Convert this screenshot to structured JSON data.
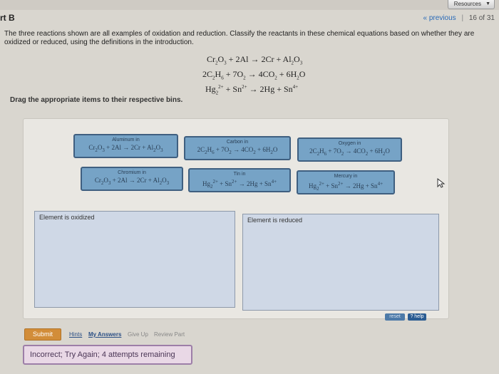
{
  "header": {
    "resources_label": "Resources",
    "part_title": "rt B",
    "previous_label": "« previous",
    "page_counter": "16 of 31"
  },
  "instructions": "The three reactions shown are all examples of oxidation and reduction. Classify the reactants in these chemical equations based on whether they are oxidized or reduced, using the definitions in the introduction.",
  "equations": [
    "Cr2O3 + 2Al → 2Cr + Al2O3",
    "2C2H6 + 7O2 → 4CO2 + 6H2O",
    "Hg2 2+ + Sn 2+ → 2Hg + Sn 4+"
  ],
  "drag_instruction": "Drag the appropriate items to their respective bins.",
  "tiles": [
    {
      "name": "Aluminum in",
      "equation": "Cr2O3 + 2Al → 2Cr + Al2O3"
    },
    {
      "name": "Carbon in",
      "equation": "2C2H6 + 7O2 → 4CO2 + 6H2O"
    },
    {
      "name": "Oxygen in",
      "equation": "2C2H6 + 7O2 → 4CO2 + 6H2O"
    },
    {
      "name": "Chromium in",
      "equation": "Cr2O3 + 2Al → 2Cr + Al2O3"
    },
    {
      "name": "Tin in",
      "equation": "Hg2 2+ + Sn 2+ → 2Hg + Sn 4+"
    },
    {
      "name": "Mercury in",
      "equation": "Hg2 2+ + Sn 2+ → 2Hg + Sn 4+"
    }
  ],
  "bins": {
    "oxidized_label": "Element is oxidized",
    "reduced_label": "Element is reduced"
  },
  "controls": {
    "reset_label": "reset",
    "help_label": "? help",
    "submit_label": "Submit",
    "hints_label": "Hints",
    "my_answers_label": "My Answers",
    "give_up_label": "Give Up",
    "review_part_label": "Review Part"
  },
  "feedback": "Incorrect; Try Again; 4 attempts remaining",
  "colors": {
    "tile_fill": "#76a3c6",
    "tile_border": "#3f5f80",
    "submit": "#d28d39",
    "feedback_bg": "#e9d8e6",
    "feedback_border": "#9d7ea8"
  }
}
